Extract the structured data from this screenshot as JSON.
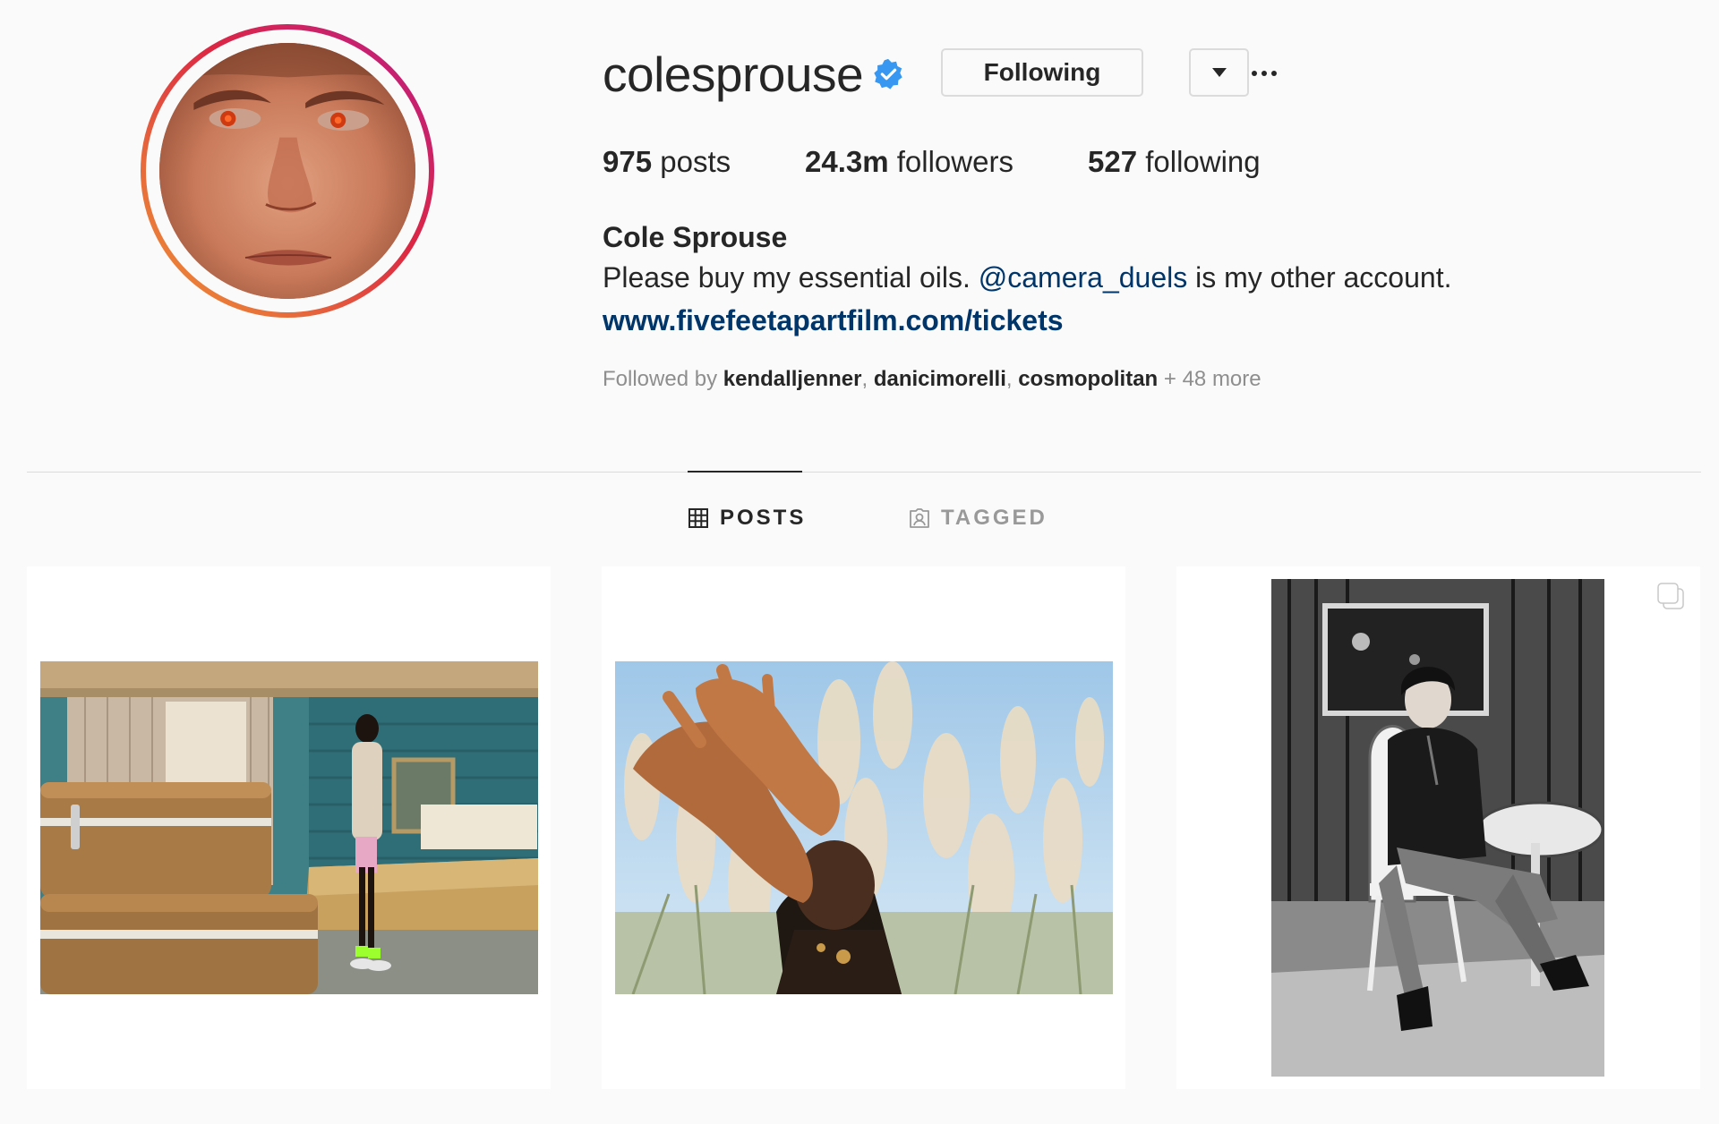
{
  "profile": {
    "username": "colesprouse",
    "verified": true,
    "following_label": "Following",
    "dropdown_icon": "caret-down-icon",
    "more_icon": "ellipsis-icon",
    "stats": {
      "posts_count": "975",
      "posts_label": "posts",
      "followers_count": "24.3m",
      "followers_label": "followers",
      "following_count": "527",
      "following_label": "following"
    },
    "full_name": "Cole Sprouse",
    "bio_before": "Please buy my essential oils. ",
    "bio_mention": "@camera_duels",
    "bio_after": " is my other account.",
    "website": "www.fivefeetapartfilm.com/tickets",
    "followed_by_label": "Followed by ",
    "followed_by": [
      "kendalljenner",
      "danicimorelli",
      "cosmopolitan"
    ],
    "followed_by_more": "+ 48 more"
  },
  "tabs": [
    {
      "label": "POSTS",
      "icon": "grid-icon",
      "active": true
    },
    {
      "label": "TAGGED",
      "icon": "tagged-icon",
      "active": false
    }
  ],
  "posts": [
    {
      "description_icon": "photo",
      "multiple": false
    },
    {
      "description_icon": "photo",
      "multiple": false
    },
    {
      "description_icon": "photo",
      "multiple": true
    }
  ],
  "colors": {
    "text": "#262626",
    "secondary_text": "#8e8e8e",
    "link": "#003569",
    "border": "#dbdbdb",
    "verified_blue": "#3897f0",
    "background": "#fafafa"
  }
}
